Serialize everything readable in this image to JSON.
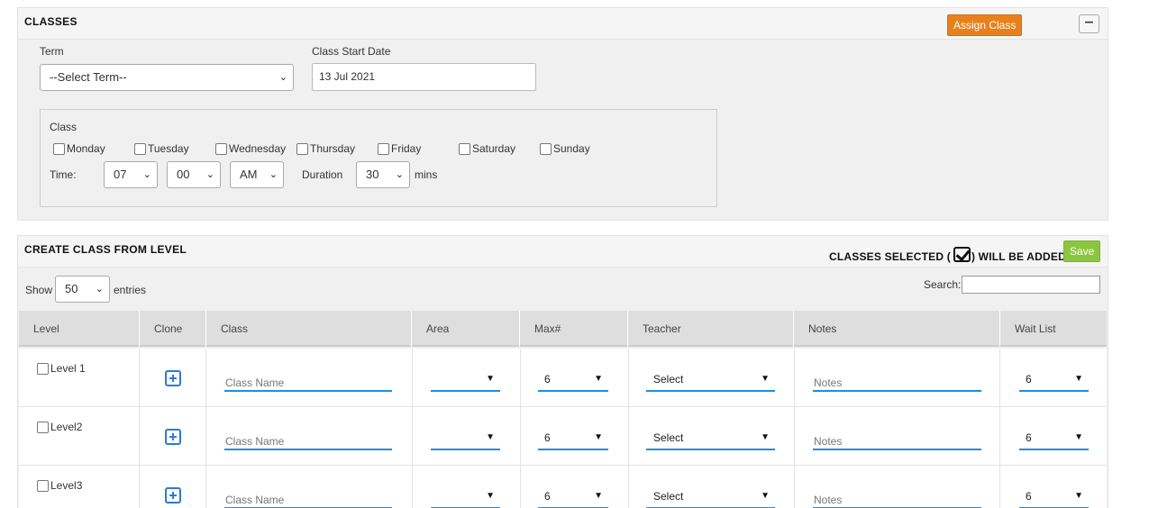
{
  "classes": {
    "title": "CLASSES",
    "assign_label": "Assign Class",
    "collapse_label": "−",
    "term": {
      "label": "Term",
      "value": "--Select Term--"
    },
    "start_date": {
      "label": "Class Start Date",
      "value": "13 Jul 2021"
    },
    "class_box": {
      "label": "Class",
      "days": [
        "Monday",
        "Tuesday",
        "Wednesday",
        "Thursday",
        "Friday",
        "Saturday",
        "Sunday"
      ],
      "time_label": "Time:",
      "hour": "07",
      "minute": "00",
      "ampm": "AM",
      "duration_label": "Duration",
      "duration": "30",
      "mins_label": "mins"
    }
  },
  "level_panel": {
    "title": "CREATE CLASS FROM LEVEL",
    "selected_prefix": "CLASSES SELECTED (",
    "selected_suffix": ") WILL BE ADDED",
    "save_label": "Save",
    "show_label": "Show",
    "entries_value": "50",
    "entries_label": "entries",
    "search_label": "Search:",
    "columns": [
      "Level",
      "Clone",
      "Class",
      "Area",
      "Max#",
      "Teacher",
      "Notes",
      "Wait List"
    ],
    "rows": [
      {
        "level": "Level 1",
        "class_placeholder": "Class Name",
        "area": "",
        "max": "6",
        "teacher": "Select",
        "notes_placeholder": "Notes",
        "wait": "6"
      },
      {
        "level": "Level2",
        "class_placeholder": "Class Name",
        "area": "",
        "max": "6",
        "teacher": "Select",
        "notes_placeholder": "Notes",
        "wait": "6"
      },
      {
        "level": "Level3",
        "class_placeholder": "Class Name",
        "area": "",
        "max": "6",
        "teacher": "Select",
        "notes_placeholder": "Notes",
        "wait": "6"
      }
    ]
  }
}
